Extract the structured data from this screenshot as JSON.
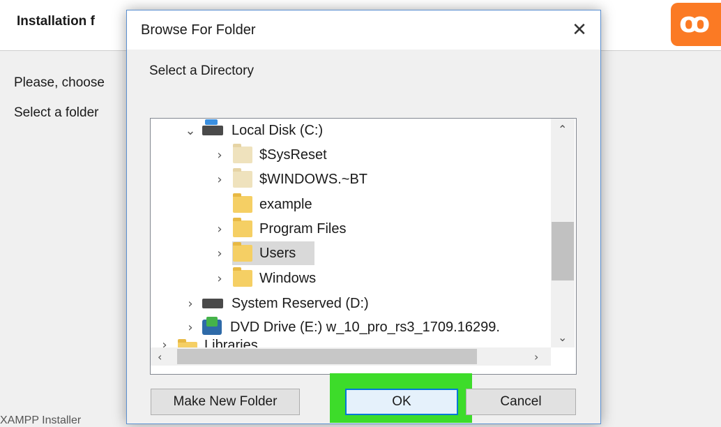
{
  "installer": {
    "title": "Installation f",
    "line1": "Please, choose",
    "line2": "Select a folder",
    "footer": "XAMPP Installer"
  },
  "dialog": {
    "title": "Browse For Folder",
    "prompt": "Select a Directory",
    "tree": [
      {
        "label": "Local Disk (C:)",
        "kind": "drive",
        "expanded": true
      },
      {
        "label": "$SysReset",
        "kind": "folder"
      },
      {
        "label": "$WINDOWS.~BT",
        "kind": "folder"
      },
      {
        "label": "example",
        "kind": "folder"
      },
      {
        "label": "Program Files",
        "kind": "folder"
      },
      {
        "label": "Users",
        "kind": "folder",
        "selected": true
      },
      {
        "label": "Windows",
        "kind": "folder"
      },
      {
        "label": "System Reserved (D:)",
        "kind": "drive"
      },
      {
        "label": "DVD Drive (E:) w_10_pro_rs3_1709.16299.",
        "kind": "dvd"
      },
      {
        "label": "Libraries",
        "kind": "folder"
      }
    ],
    "buttons": {
      "make_new_folder": "Make New Folder",
      "ok": "OK",
      "cancel": "Cancel"
    }
  },
  "colors": {
    "highlight": "#3ddc2a",
    "accent": "#0078d7",
    "xampp_orange": "#fb7a24"
  }
}
